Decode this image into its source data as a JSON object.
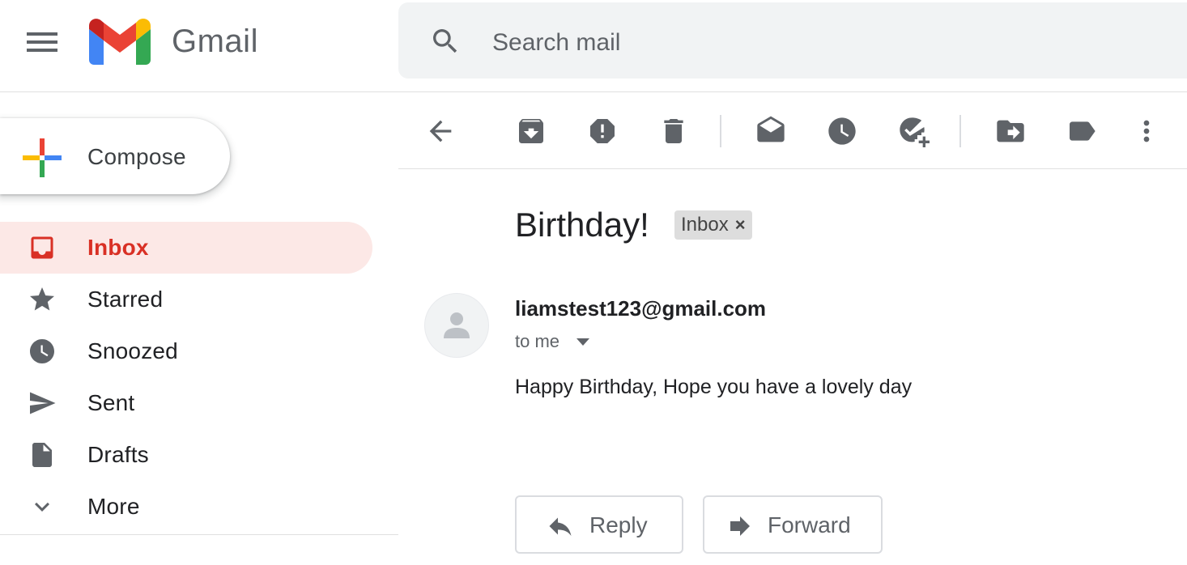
{
  "app": {
    "title": "Gmail"
  },
  "search": {
    "placeholder": "Search mail"
  },
  "compose": {
    "label": "Compose"
  },
  "sidebar": {
    "items": [
      {
        "label": "Inbox",
        "icon": "inbox-icon",
        "active": true
      },
      {
        "label": "Starred",
        "icon": "star-icon"
      },
      {
        "label": "Snoozed",
        "icon": "clock-icon"
      },
      {
        "label": "Sent",
        "icon": "send-icon"
      },
      {
        "label": "Drafts",
        "icon": "draft-icon"
      },
      {
        "label": "More",
        "icon": "chevron-down-icon"
      }
    ]
  },
  "toolbar": {
    "icons": [
      "back-arrow-icon",
      "archive-icon",
      "report-spam-icon",
      "delete-icon",
      "mark-unread-icon",
      "snooze-icon",
      "add-to-tasks-icon",
      "move-to-icon",
      "label-icon",
      "more-vert-icon"
    ]
  },
  "message": {
    "subject": "Birthday!",
    "label_chip": "Inbox",
    "label_chip_close": "×",
    "sender": "liamstest123@gmail.com",
    "recipient": "to me",
    "body": "Happy Birthday, Hope you have a lovely day"
  },
  "actions": {
    "reply_label": "Reply",
    "forward_label": "Forward"
  },
  "colors": {
    "accent_red": "#d93025",
    "active_bg": "#fce8e6",
    "icon_grey": "#5f6368",
    "search_bg": "#f1f3f4"
  }
}
